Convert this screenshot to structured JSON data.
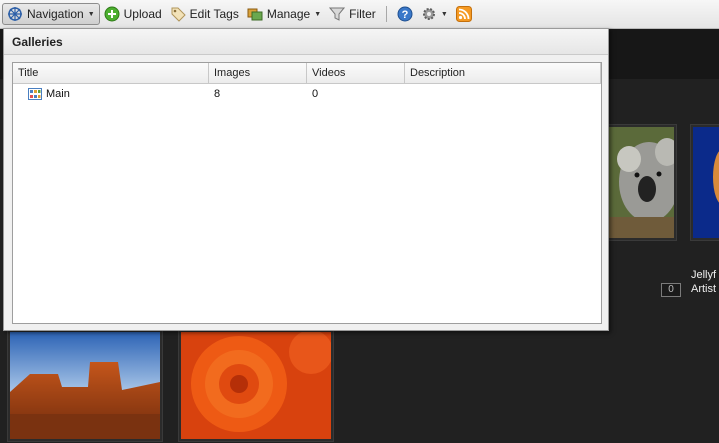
{
  "toolbar": {
    "navigation_label": "Navigation",
    "upload_label": "Upload",
    "edit_tags_label": "Edit Tags",
    "manage_label": "Manage",
    "filter_label": "Filter"
  },
  "panel": {
    "title": "Galleries",
    "columns": [
      "Title",
      "Images",
      "Videos",
      "Description"
    ],
    "rows": [
      {
        "title": "Main",
        "images": "8",
        "videos": "0",
        "description": ""
      }
    ]
  },
  "background": {
    "item_caption_line1": "Jellyf",
    "item_caption_line2": "Artist",
    "item_count": "0"
  },
  "colors": {
    "page_background": "#212121",
    "toolbar_background": "#ececec",
    "panel_background": "#f0f0f0",
    "rss_orange": "#f59a23",
    "help_blue": "#3a78c9"
  },
  "icons": [
    "navigation-icon",
    "upload-icon",
    "edit-tags-icon",
    "manage-icon",
    "filter-icon",
    "help-icon",
    "settings-icon",
    "rss-icon",
    "gallery-icon"
  ]
}
